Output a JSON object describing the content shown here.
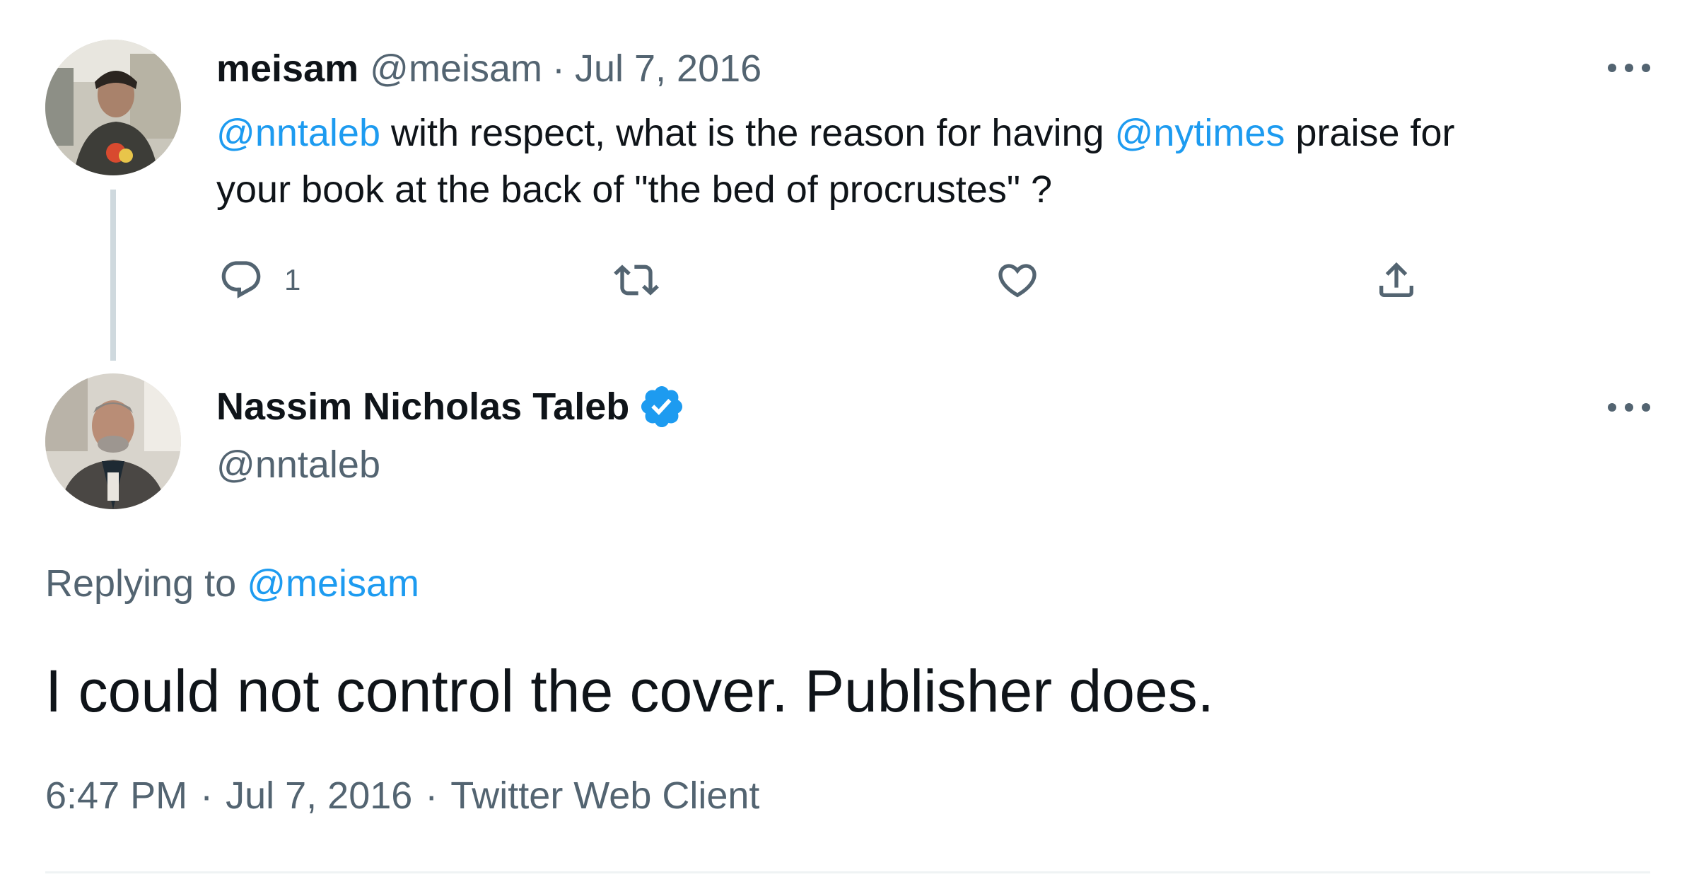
{
  "parent_tweet": {
    "display_name": "meisam",
    "handle": "@meisam",
    "separator": "·",
    "date": "Jul 7, 2016",
    "text": {
      "mention1": "@nntaleb",
      "part1": " with respect, what is the reason for having ",
      "mention2": "@nytimes",
      "part2": " praise for",
      "line2": "your book at the back of \"the bed of procrustes\" ?"
    },
    "actions": {
      "reply_count": "1"
    }
  },
  "main_tweet": {
    "display_name": "Nassim Nicholas Taleb",
    "handle": "@nntaleb",
    "replying_prefix": "Replying to",
    "replying_to": "@meisam",
    "text": "I could not control the cover. Publisher does.",
    "time": "6:47 PM",
    "separator1": "·",
    "date": "Jul 7, 2016",
    "separator2": "·",
    "source": "Twitter Web Client"
  },
  "colors": {
    "accent": "#1d9bf0",
    "muted_text": "#536471",
    "primary_text": "#0f1419",
    "thread_line": "#cfd9de"
  },
  "icons": [
    "more-icon",
    "reply-icon",
    "retweet-icon",
    "like-icon",
    "share-icon",
    "verified-badge-icon"
  ]
}
